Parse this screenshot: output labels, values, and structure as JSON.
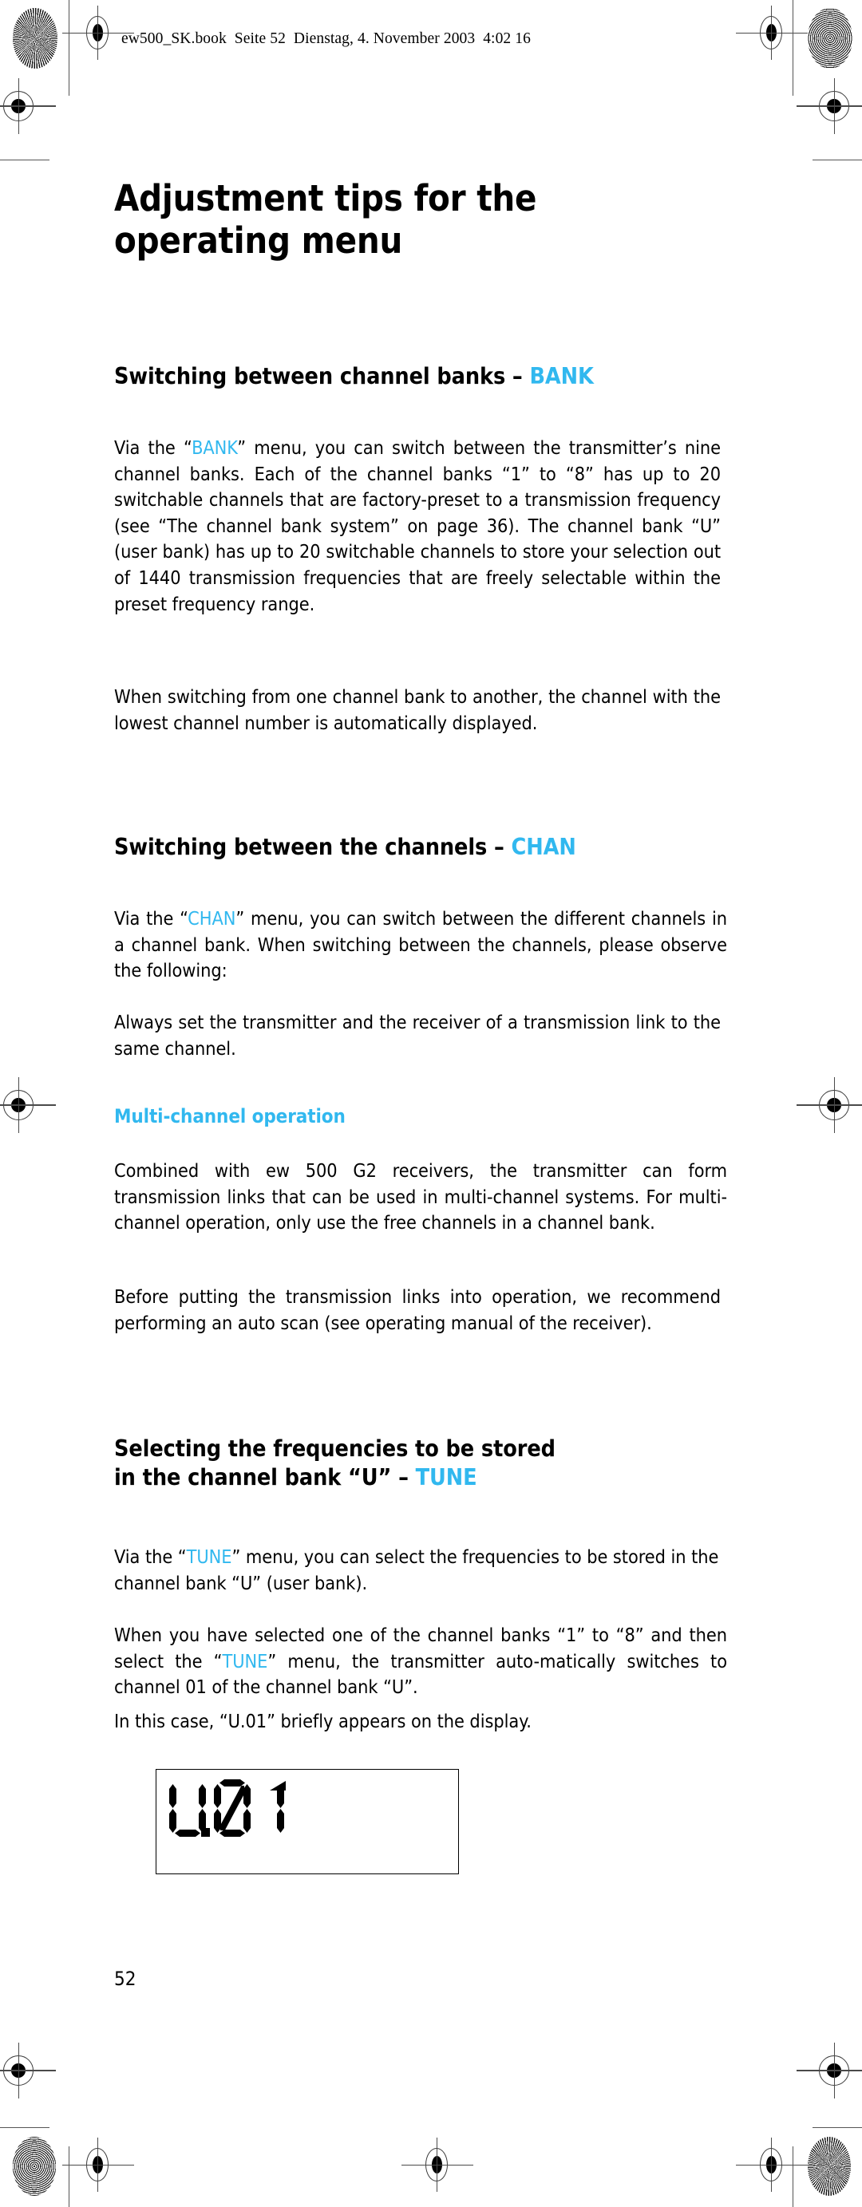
{
  "document": {
    "slug": "ew500_SK.book  Seite 52  Dienstag, 4. November 2003  4:02 16",
    "page_number": "52",
    "accent_color": "#31b8ef"
  },
  "title": {
    "line1": "Adjustment tips for the",
    "line2": "operating menu"
  },
  "sections": [
    {
      "heading_prefix": "Switching between channel banks – ",
      "heading_accent": "BANK",
      "paragraphs": [
        {
          "parts": [
            {
              "text": "Via the “",
              "accent": false
            },
            {
              "text": "BANK",
              "accent": true
            },
            {
              "text": "” menu, you can switch between the transmitter’s nine channel banks. Each of the channel banks “1” to “8” has up to 20 switchable channels that are factory-preset to a transmission frequency (see “The channel bank system” on page 36). The channel bank “U” (user bank) has up to 20 switchable channels to store your selection out of 1440 transmission frequencies that are freely selectable within the preset frequency range.",
              "accent": false
            }
          ]
        },
        {
          "parts": [
            {
              "text": "When switching from one channel bank to another, the channel with the lowest channel number is automatically displayed.",
              "accent": false
            }
          ]
        }
      ]
    },
    {
      "heading_prefix": "Switching between the channels  – ",
      "heading_accent": "CHAN",
      "paragraphs": [
        {
          "parts": [
            {
              "text": "Via the “",
              "accent": false
            },
            {
              "text": "CHAN",
              "accent": true
            },
            {
              "text": "” menu, you can switch between the different channels in a channel bank. When switching between the channels, please observe the following:",
              "accent": false
            }
          ]
        },
        {
          "parts": [
            {
              "text": "Always set the transmitter and the receiver of a transmission link to the same channel.",
              "accent": false
            }
          ]
        }
      ],
      "subsection": {
        "heading": "Multi-channel operation",
        "paragraphs": [
          {
            "parts": [
              {
                "text": "Combined with ew 500 G2 receivers, the transmitter can form transmission links that can be used in multi-channel systems. For multi-channel operation, only use the free channels in a channel bank.",
                "accent": false
              }
            ]
          },
          {
            "parts": [
              {
                "text": "Before putting the transmission links into operation, we recommend performing an auto scan (see operating manual of the receiver).",
                "accent": false
              }
            ]
          }
        ]
      }
    },
    {
      "heading_line1": "Selecting the frequencies to be stored",
      "heading_line2_prefix": "in the channel bank “U” – ",
      "heading_accent": "TUNE",
      "paragraphs": [
        {
          "parts": [
            {
              "text": "Via the “",
              "accent": false
            },
            {
              "text": "TUNE",
              "accent": true
            },
            {
              "text": "” menu, you can select the frequencies to be stored in the channel bank “U” (user bank).",
              "accent": false
            }
          ]
        },
        {
          "parts": [
            {
              "text": "When you have selected one of the channel banks “1” to “8” and then select the “",
              "accent": false
            },
            {
              "text": "TUNE",
              "accent": true
            },
            {
              "text": "” menu, the transmitter auto-matically switches to channel 01 of the channel bank “U”.",
              "accent": false
            }
          ]
        },
        {
          "parts": [
            {
              "text": "In this case, “U.01” briefly appears on the display.",
              "accent": false
            }
          ]
        }
      ]
    }
  ],
  "figure": {
    "name": "lcd-display",
    "display_text": "U.01"
  }
}
